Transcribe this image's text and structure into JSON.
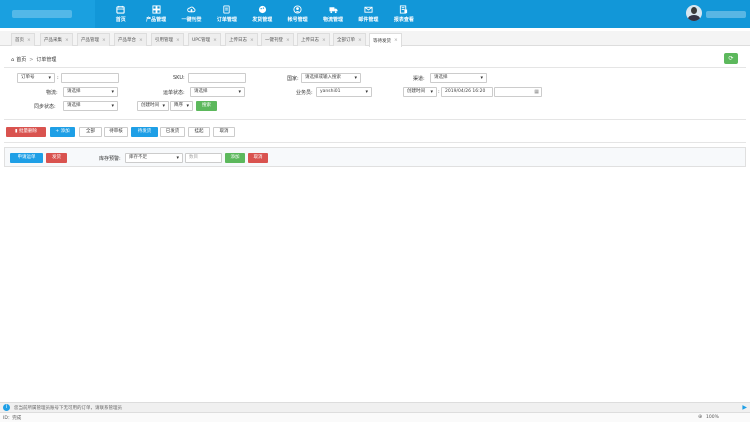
{
  "nav": [
    {
      "label": "首页",
      "icon": "calendar-icon"
    },
    {
      "label": "产品管理",
      "icon": "grid-icon"
    },
    {
      "label": "一键刊登",
      "icon": "cloud-upload-icon"
    },
    {
      "label": "订单管理",
      "icon": "document-icon"
    },
    {
      "label": "发货管理",
      "icon": "palette-icon"
    },
    {
      "label": "帐号管理",
      "icon": "user-circle-icon"
    },
    {
      "label": "物流管理",
      "icon": "truck-icon"
    },
    {
      "label": "邮件管理",
      "icon": "envelope-icon"
    },
    {
      "label": "报表查看",
      "icon": "report-icon"
    }
  ],
  "tabs": [
    "首页",
    "产品采集",
    "产品管理",
    "产品草合",
    "引用管理",
    "UPC管理",
    "上传日志",
    "一键刊登",
    "上传日志",
    "全部订单",
    "等待发货"
  ],
  "breadcrumb": {
    "home": "首页",
    "current": "订单管理"
  },
  "filters": {
    "order_no_select": "订单号",
    "colon": ":",
    "sku_label": "SKU:",
    "country_label": "国家:",
    "country_placeholder": "请选择或输入搜索",
    "channel_label": "渠道:",
    "channel_value": "请选择",
    "logistics_label": "物流:",
    "logistics_value": "请选择",
    "shipping_status_label": "运单状态:",
    "shipping_status_value": "请选择",
    "account_label": "业务员:",
    "account_value": "yanshi01",
    "time_select": "创建时间",
    "date_value": "2019/04/26 16:20",
    "sync_label": "同步状态:",
    "sync_value": "请选择",
    "sort_time": "创建时间",
    "sort_order": "降序",
    "search_label": "搜索"
  },
  "actions": {
    "bulk_delete": "批量删除",
    "add": "添加",
    "status_tabs": [
      "全部",
      "待审核",
      "待发货",
      "已发货",
      "挂起",
      "取消"
    ]
  },
  "panel": {
    "apply_waybill": "申请运单",
    "ship": "发货",
    "stock_label": "库存预警:",
    "stock_value": "库存不足",
    "qty_placeholder": "数目",
    "add_btn": "添加",
    "cancel_btn": "取消"
  },
  "statusbar": {
    "text": "您当前所属管理员账号下无可用的订单，请联系管理员"
  },
  "bottom": {
    "left": "ID：完成",
    "zoom": "100%"
  },
  "colors": {
    "primary": "#1297d8",
    "green": "#5cb85c",
    "red": "#d9534f",
    "blue": "#1e9fe6"
  }
}
